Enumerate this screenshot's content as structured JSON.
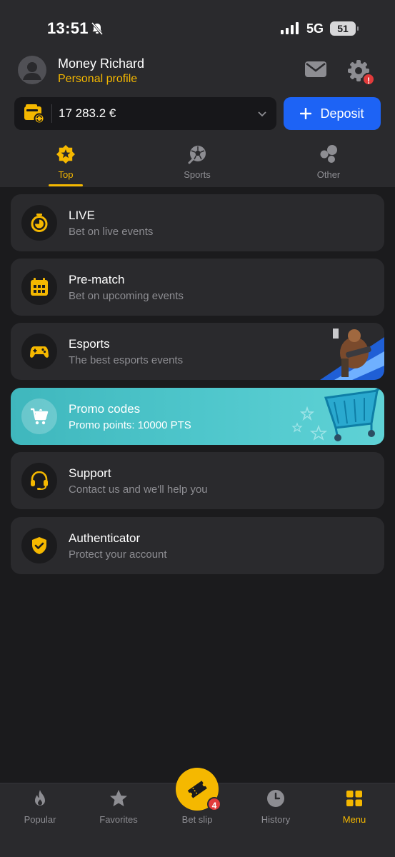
{
  "status_bar": {
    "time": "13:51",
    "network": "5G",
    "battery": "51"
  },
  "header": {
    "user_name": "Money Richard",
    "profile_link": "Personal profile",
    "settings_badge": "!",
    "balance": "17 283.2 €",
    "deposit_label": "Deposit"
  },
  "tabs": [
    {
      "label": "Top",
      "icon": "star-badge-icon",
      "active": true
    },
    {
      "label": "Sports",
      "icon": "soccer-ball-icon",
      "active": false
    },
    {
      "label": "Other",
      "icon": "bubbles-icon",
      "active": false
    }
  ],
  "menu": [
    {
      "title": "LIVE",
      "subtitle": "Bet on live events",
      "icon": "stopwatch-icon"
    },
    {
      "title": "Pre-match",
      "subtitle": "Bet on upcoming events",
      "icon": "calendar-icon"
    },
    {
      "title": "Esports",
      "subtitle": "The best esports events",
      "icon": "gamepad-icon"
    },
    {
      "title": "Promo codes",
      "subtitle": "Promo points: 10000 PTS",
      "icon": "cart-icon"
    },
    {
      "title": "Support",
      "subtitle": "Contact us and we'll help you",
      "icon": "headset-icon"
    },
    {
      "title": "Authenticator",
      "subtitle": "Protect your account",
      "icon": "shield-check-icon"
    }
  ],
  "bottom_nav": [
    {
      "label": "Popular",
      "icon": "flame-icon",
      "active": false
    },
    {
      "label": "Favorites",
      "icon": "star-icon",
      "active": false
    },
    {
      "label": "Bet slip",
      "icon": "ticket-icon",
      "active": false,
      "badge": "4"
    },
    {
      "label": "History",
      "icon": "clock-icon",
      "active": false
    },
    {
      "label": "Menu",
      "icon": "grid-icon",
      "active": true
    }
  ],
  "colors": {
    "accent": "#f5b800",
    "deposit": "#1d63f5",
    "promo": "#4ec6cb",
    "badge": "#e23b3b"
  }
}
